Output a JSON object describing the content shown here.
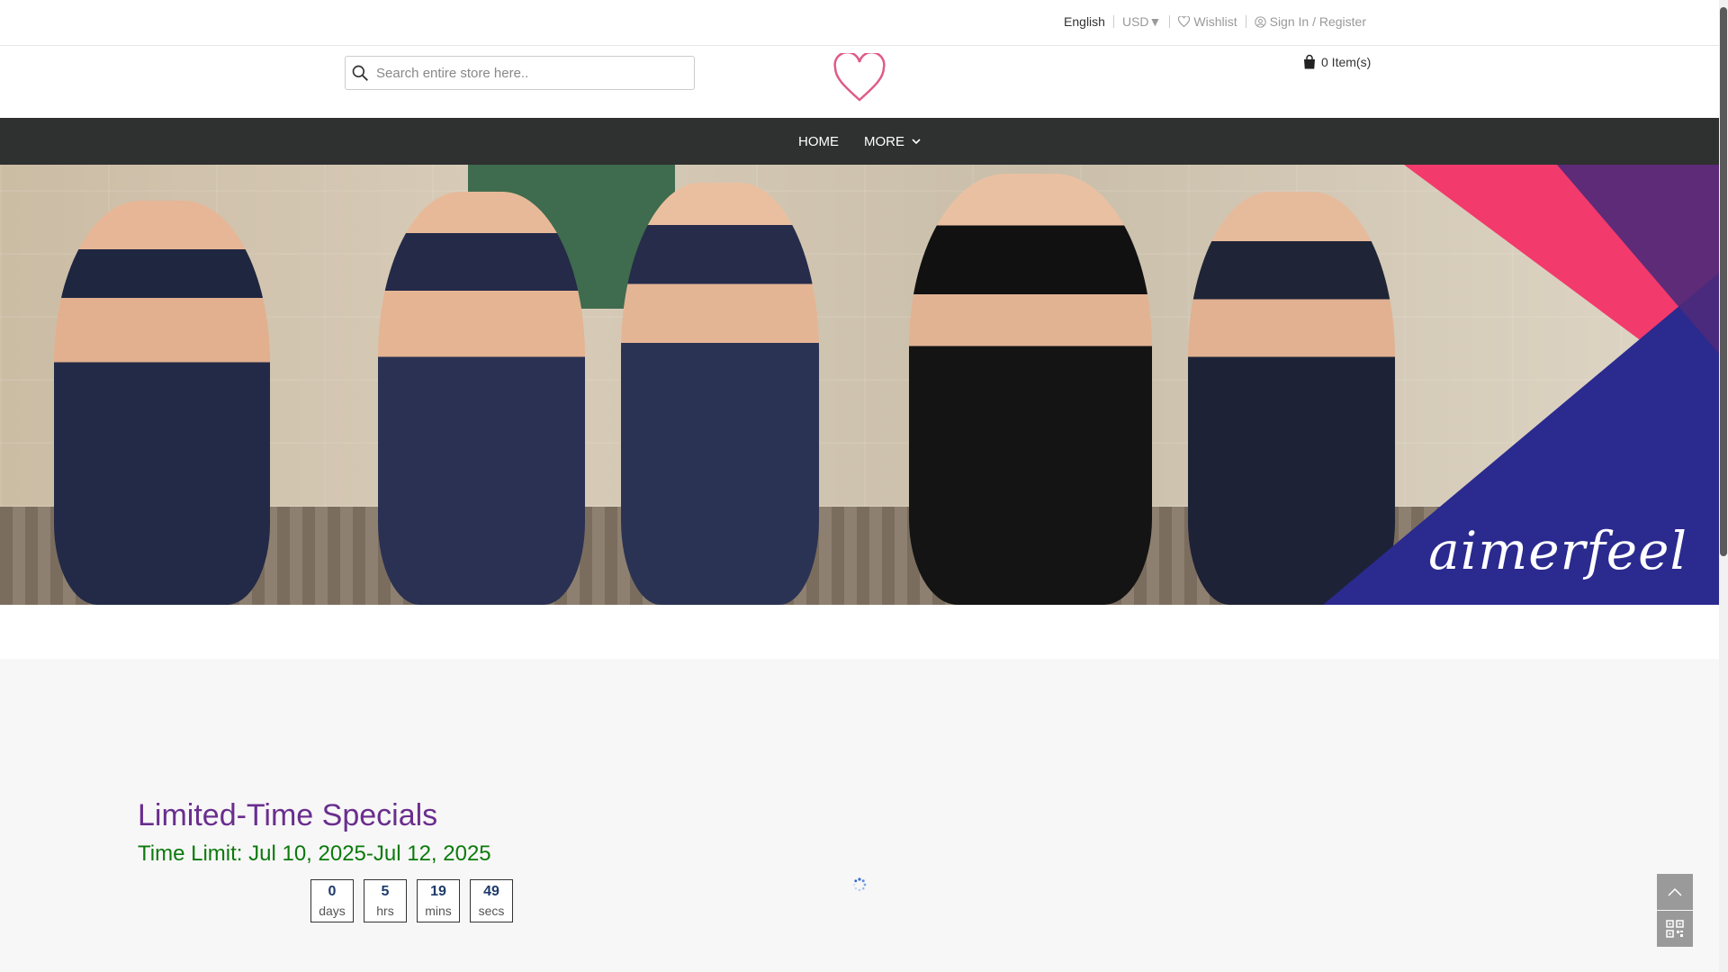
{
  "topbar": {
    "language": "English",
    "currency": "USD▼",
    "wishlist": "Wishlist",
    "signin": "Sign In / Register"
  },
  "header": {
    "search_placeholder": "Search entire store here..",
    "cart_label": "0 Item(s)",
    "logo_icon": "heart-outline-logo",
    "logo_color": "#e05a8a"
  },
  "nav": {
    "items": [
      {
        "label": "HOME"
      },
      {
        "label": "MORE"
      }
    ]
  },
  "banner": {
    "brand_text": "aimerfeel",
    "accent_colors": [
      "#f23a6c",
      "#2b2a8f",
      "#4e2a7a"
    ]
  },
  "specials": {
    "title": "Limited-Time Specials",
    "time_limit": "Time Limit: Jul 10, 2025-Jul 12, 2025",
    "countdown": [
      {
        "value": "0",
        "unit": "days"
      },
      {
        "value": "5",
        "unit": "hrs"
      },
      {
        "value": "19",
        "unit": "mins"
      },
      {
        "value": "49",
        "unit": "secs"
      }
    ],
    "title_color": "#6a2e8e",
    "time_color": "#0c7a0c"
  },
  "floating": {
    "back_to_top_icon": "chevron-up-icon",
    "qr_icon": "qr-code-icon"
  }
}
